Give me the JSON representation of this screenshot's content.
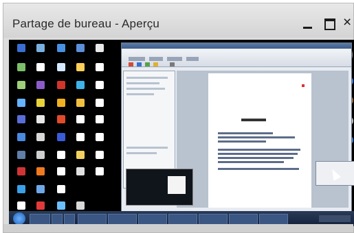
{
  "window": {
    "title": "Partage de bureau - Aperçu",
    "minimize_icon": "minimize-icon",
    "maximize_icon": "maximize-icon",
    "close_icon": "close-icon",
    "close_glyph": "×"
  }
}
